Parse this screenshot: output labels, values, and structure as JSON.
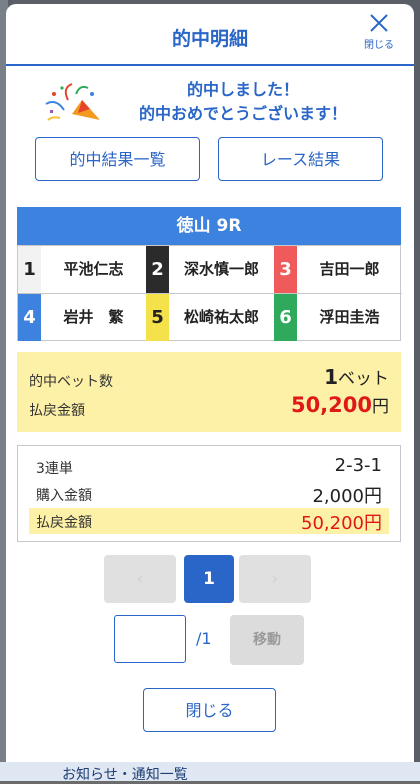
{
  "background": {
    "footer_link": "お知らせ・通知一覧"
  },
  "modal": {
    "title": "的中明細",
    "close_label": "閉じる",
    "congrats": {
      "line1": "的中しました！",
      "line2": "的中おめでとうございます！"
    },
    "buttons": {
      "hit_results_list": "的中結果一覧",
      "race_results": "レース結果",
      "close": "閉じる"
    },
    "race": {
      "title": "徳山 9R",
      "riders": [
        {
          "num": "1",
          "name": "平池仁志",
          "color": "#f2f2f2",
          "text_color": "#222222"
        },
        {
          "num": "2",
          "name": "深水慎一郎",
          "color": "#2b2b2b",
          "text_color": "#ffffff"
        },
        {
          "num": "3",
          "name": "吉田一郎",
          "color": "#ef5a5a",
          "text_color": "#ffffff"
        },
        {
          "num": "4",
          "name": "岩井　繁",
          "color": "#3d82de",
          "text_color": "#ffffff"
        },
        {
          "num": "5",
          "name": "松崎祐太郎",
          "color": "#f5e24a",
          "text_color": "#222222"
        },
        {
          "num": "6",
          "name": "浮田圭浩",
          "color": "#2fa95c",
          "text_color": "#ffffff"
        }
      ]
    },
    "summary": {
      "bets_label": "的中ベット数",
      "bets_value": "1",
      "bets_unit": "ベット",
      "payout_label": "払戻金額",
      "payout_value": "50,200",
      "payout_unit": "円"
    },
    "detail": {
      "bet_type_label": "3連単",
      "bet_type_value": "2-3-1",
      "purchase_label": "購入金額",
      "purchase_value": "2,000円",
      "payout_label": "払戻金額",
      "payout_value": "50,200円"
    },
    "pager": {
      "current_page": "1",
      "prev_glyph": "‹",
      "next_glyph": "›",
      "input_value": "",
      "total": "/1",
      "move_label": "移動"
    },
    "colors": {
      "accent": "#2a66c7",
      "race_header": "#3d82de",
      "highlight": "#fdf1a8",
      "payout_red": "#e01818"
    }
  }
}
